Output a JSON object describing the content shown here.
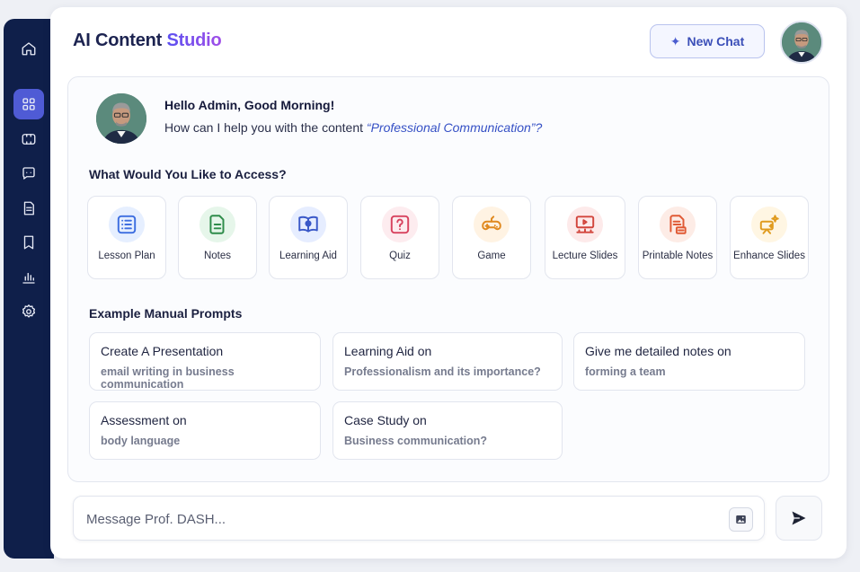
{
  "app": {
    "title_main": "AI Content",
    "title_accent": "Studio",
    "new_chat_label": "New Chat"
  },
  "sidebar": {
    "items": [
      {
        "name": "home-icon",
        "active": false
      },
      {
        "name": "dashboard-grid-icon",
        "active": true
      },
      {
        "name": "content-icon",
        "active": false
      },
      {
        "name": "chat-icon",
        "active": false
      },
      {
        "name": "document-icon",
        "active": false
      },
      {
        "name": "bookmark-icon",
        "active": false
      },
      {
        "name": "analytics-icon",
        "active": false
      },
      {
        "name": "settings-icon",
        "active": false
      }
    ]
  },
  "greeting": {
    "title": "Hello Admin, Good Morning!",
    "prefix": "How can I help you with the content ",
    "open_quote": "“",
    "topic": "Professional Communication",
    "close_quote": "”?"
  },
  "access": {
    "heading": "What Would You Like to Access?",
    "tiles": [
      {
        "label": "Lesson Plan",
        "icon": "list-icon"
      },
      {
        "label": "Notes",
        "icon": "notes-icon"
      },
      {
        "label": "Learning Aid",
        "icon": "book-icon"
      },
      {
        "label": "Quiz",
        "icon": "question-icon"
      },
      {
        "label": "Game",
        "icon": "gamepad-icon"
      },
      {
        "label": "Lecture Slides",
        "icon": "presentation-icon"
      },
      {
        "label": "Printable Notes",
        "icon": "printable-notes-icon"
      },
      {
        "label": "Enhance Slides",
        "icon": "sparkle-slides-icon"
      }
    ]
  },
  "prompts": {
    "heading": "Example Manual Prompts",
    "items": [
      {
        "title": "Create A Presentation",
        "detail": "email writing in business communication"
      },
      {
        "title": "Learning Aid on",
        "detail": "Professionalism and its importance?"
      },
      {
        "title": "Give me detailed notes on",
        "detail": "forming a team"
      },
      {
        "title": "Assessment on",
        "detail": "body language"
      },
      {
        "title": "Case Study on",
        "detail": "Business communication?"
      }
    ]
  },
  "composer": {
    "placeholder": "Message Prof. DASH...",
    "value": ""
  },
  "colors": {
    "sidebar": "#0f1f4a",
    "accent": "#4f5bd5"
  }
}
